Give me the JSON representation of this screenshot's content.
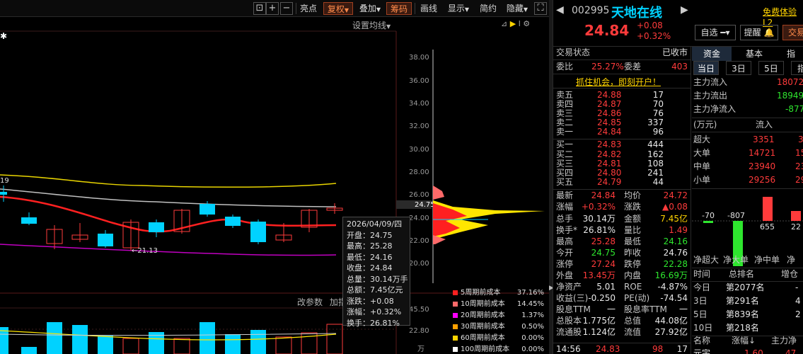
{
  "toolbar": {
    "buttons": [
      "亮点",
      "复权",
      "叠加",
      "筹码",
      "画线",
      "显示",
      "简约",
      "隐藏"
    ],
    "zoom_in": "+",
    "zoom_out": "−"
  },
  "chart": {
    "avg_line_setting": "设置均线",
    "price_ticks": [
      "38.00",
      "36.00",
      "34.00",
      "32.00",
      "30.00",
      "28.00",
      "26.00",
      "24.00",
      "22.00",
      "20.00"
    ],
    "current_price_tag": "24.75",
    "left_tag": "19",
    "min_label": "←21.13",
    "volume_ticks": [
      "45.50",
      "22.80",
      "万"
    ],
    "sub_labels": [
      "改参数",
      "加指"
    ],
    "tooltip": {
      "date": "2026/04/09/四",
      "rows": [
        {
          "k": "开盘",
          "v": "24.75"
        },
        {
          "k": "最高",
          "v": "25.28"
        },
        {
          "k": "最低",
          "v": "24.16"
        },
        {
          "k": "收盘",
          "v": "24.84"
        },
        {
          "k": "总量",
          "v": "30.14万手"
        },
        {
          "k": "总额",
          "v": "7.45亿元"
        },
        {
          "k": "涨跌",
          "v": "+0.08"
        },
        {
          "k": "涨幅",
          "v": "+0.32%"
        },
        {
          "k": "换手",
          "v": "26.81%"
        }
      ]
    },
    "cost_legend": [
      {
        "label": "5周期前成本",
        "pct": "37.16%",
        "color": "#ff2020"
      },
      {
        "label": "10周期前成本",
        "pct": "14.45%",
        "color": "#ff6a6a"
      },
      {
        "label": "20周期前成本",
        "pct": "1.37%",
        "color": "#ff00ff"
      },
      {
        "label": "30周期前成本",
        "pct": "0.50%",
        "color": "#ffa000"
      },
      {
        "label": "60周期前成本",
        "pct": "0.00%",
        "color": "#ffd400"
      },
      {
        "label": "100周期前成本",
        "pct": "0.00%",
        "color": "#ffffff"
      }
    ]
  },
  "quote": {
    "code": "002995",
    "name": "天地在线",
    "promo": "免费体验L2",
    "price": "24.84",
    "change": "+0.08",
    "change_pct": "+0.32%",
    "watch_btn": "自选",
    "remind_btn": "提醒",
    "trade_btn": "交易",
    "status_label": "交易状态",
    "status_value": "已收市",
    "ratio_label": "委比",
    "ratio_value": "25.27%",
    "diff_label": "委差",
    "diff_value": "403",
    "ad_text": "抓住机会，即刻开户！"
  },
  "order_book": {
    "asks": [
      {
        "label": "卖五",
        "price": "24.88",
        "vol": "17"
      },
      {
        "label": "卖四",
        "price": "24.87",
        "vol": "70"
      },
      {
        "label": "卖三",
        "price": "24.86",
        "vol": "76"
      },
      {
        "label": "卖二",
        "price": "24.85",
        "vol": "337"
      },
      {
        "label": "卖一",
        "price": "24.84",
        "vol": "96"
      }
    ],
    "bids": [
      {
        "label": "买一",
        "price": "24.83",
        "vol": "444"
      },
      {
        "label": "买二",
        "price": "24.82",
        "vol": "162"
      },
      {
        "label": "买三",
        "price": "24.81",
        "vol": "108"
      },
      {
        "label": "买四",
        "price": "24.80",
        "vol": "241"
      },
      {
        "label": "买五",
        "price": "24.79",
        "vol": "44"
      }
    ]
  },
  "stats": [
    {
      "k1": "最新",
      "v1": "24.84",
      "k2": "均价",
      "v2": "24.72"
    },
    {
      "k1": "涨幅",
      "v1": "+0.32%",
      "k2": "涨跌",
      "v2": "▲0.08"
    },
    {
      "k1": "总手",
      "v1": "30.14万",
      "k2": "金额",
      "v2": "7.45亿"
    },
    {
      "k1": "换手*",
      "v1": "26.81%",
      "k2": "量比",
      "v2": "1.49"
    },
    {
      "k1": "最高",
      "v1": "25.28",
      "k2": "最低",
      "v2": "24.16"
    },
    {
      "k1": "今开",
      "v1": "24.75",
      "k2": "昨收",
      "v2": "24.76"
    },
    {
      "k1": "涨停",
      "v1": "27.24",
      "k2": "跌停",
      "v2": "22.28"
    },
    {
      "k1": "外盘",
      "v1": "13.45万",
      "k2": "内盘",
      "v2": "16.69万"
    },
    {
      "k1": "净资产",
      "v1": "5.01",
      "k2": "ROE",
      "v2": "-4.87%"
    },
    {
      "k1": "收益(三)",
      "v1": "-0.250",
      "k2": "PE(动)",
      "v2": "-74.54"
    },
    {
      "k1": "股息TTM",
      "v1": "一",
      "k2": "股息率TTM",
      "v2": "一"
    },
    {
      "k1": "总股本",
      "v1": "1.775亿",
      "k2": "总值",
      "v2": "44.08亿"
    },
    {
      "k1": "流通股",
      "v1": "1.124亿",
      "k2": "流值",
      "v2": "27.92亿"
    }
  ],
  "last_trade": {
    "time": "14:56",
    "price": "24.83",
    "vol": "98",
    "extra": "17"
  },
  "fund": {
    "tabs": [
      "资金",
      "基本",
      "指"
    ],
    "periods": [
      "当日",
      "3日",
      "5日",
      "指"
    ],
    "main_in_label": "主力流入",
    "main_in": "18072",
    "main_out_label": "主力流出",
    "main_out": "18949",
    "main_net_label": "主力净流入",
    "main_net": "-877",
    "unit": "(万元)",
    "in_col": "流入",
    "rows": [
      {
        "k": "超大",
        "v": "3351",
        "v2": "3"
      },
      {
        "k": "大单",
        "v": "14721",
        "v2": "15"
      },
      {
        "k": "中单",
        "v": "23940",
        "v2": "23"
      },
      {
        "k": "小单",
        "v": "29256",
        "v2": "29"
      }
    ],
    "bar_values": [
      "-70",
      "-807",
      "655",
      "22"
    ],
    "bar_labels": [
      "净超大",
      "净大单",
      "净中单",
      "净"
    ],
    "rank_time": "时间",
    "rank_col": "总排名",
    "rank_col2": "增仓",
    "ranks": [
      {
        "k": "今日",
        "v": "第2077名",
        "v2": "-"
      },
      {
        "k": "3日",
        "v": "第291名",
        "v2": "4"
      },
      {
        "k": "5日",
        "v": "第839名",
        "v2": "2"
      },
      {
        "k": "10日",
        "v": "第218名",
        "v2": ""
      }
    ],
    "bottom_cols": [
      "名称",
      "涨幅↓",
      "主力净"
    ],
    "bottom_row": {
      "name": "元宇",
      "v1": "1.60",
      "v2": "47"
    }
  }
}
